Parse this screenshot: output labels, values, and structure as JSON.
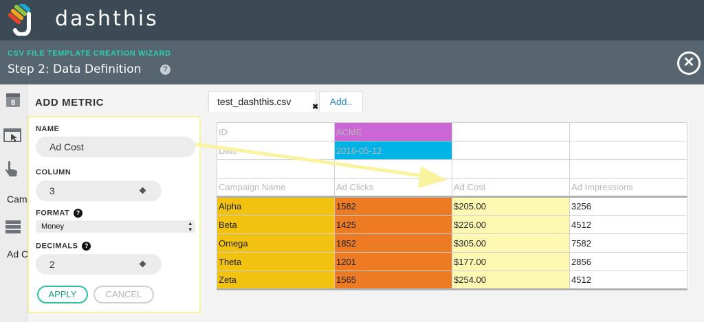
{
  "brand": {
    "name": "dashthis"
  },
  "wizard": {
    "title": "CSV FILE TEMPLATE CREATION WIZARD",
    "step": "Step 2: Data Definition",
    "help": "?",
    "close": "✕"
  },
  "sidebar": {
    "items": [
      {
        "icon": "calendar-icon",
        "label": ""
      },
      {
        "icon": "window-cursor-icon",
        "label": ""
      },
      {
        "icon": "pointer-hand-icon",
        "label": "Cam"
      },
      {
        "icon": "list-icon",
        "label": "Ad C"
      }
    ]
  },
  "panel": {
    "title": "ADD METRIC",
    "name": {
      "label": "NAME",
      "value": "Ad Cost"
    },
    "column": {
      "label": "COLUMN",
      "value": "3"
    },
    "format": {
      "label": "FORMAT",
      "value": "Money",
      "help": "?"
    },
    "decimals": {
      "label": "DECIMALS",
      "value": "2",
      "help": "?"
    },
    "apply": "APPLY",
    "cancel": "CANCEL"
  },
  "tabs": {
    "file": "test_dashthis.csv",
    "close": "✖",
    "add": "Add.."
  },
  "sheet": {
    "meta_rows": [
      [
        "ID",
        "ACME",
        "",
        ""
      ],
      [
        "Date",
        "2016-05-12",
        "",
        ""
      ],
      [
        "",
        "",
        "",
        ""
      ]
    ],
    "headers": [
      "Campaign Name",
      "Ad Clicks",
      "Ad Cost",
      "Ad Impressions"
    ],
    "rows": [
      [
        "Alpha",
        "1582",
        "$205.00",
        "3256"
      ],
      [
        "Beta",
        "1425",
        "$226.00",
        "4512"
      ],
      [
        "Omega",
        "1852",
        "$305.00",
        "7582"
      ],
      [
        "Theta",
        "1201",
        "$177.00",
        "2856"
      ],
      [
        "Zeta",
        "1565",
        "$254.00",
        "4512"
      ]
    ]
  },
  "colors": {
    "accent": "#2ecfb0",
    "topbar": "#3c4a55",
    "wizbar": "#56656f",
    "highlight": "#fdf9b3"
  }
}
